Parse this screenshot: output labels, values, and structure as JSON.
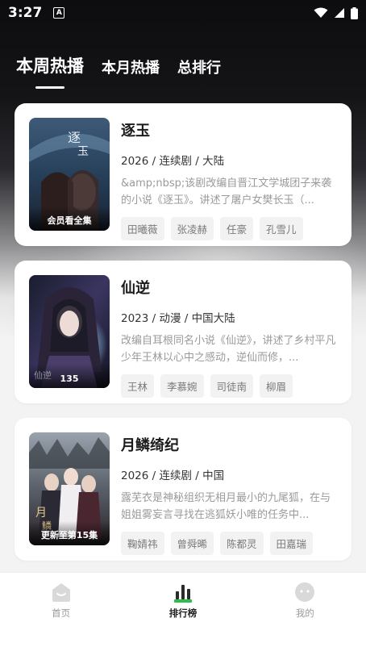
{
  "status": {
    "time": "3:27",
    "app_icon_letter": "A"
  },
  "tabs": [
    {
      "label": "本周热播",
      "active": true
    },
    {
      "label": "本月热播",
      "active": false
    },
    {
      "label": "总排行",
      "active": false
    }
  ],
  "items": [
    {
      "title": "逐玉",
      "meta": "2026 / 连续剧 / 大陆",
      "desc": "&amp;nbsp;该剧改编自晋江文学城团子来袭的小说《逐玉》。讲述了屠户女樊长玉（...",
      "badge": "会员看全集",
      "tags": [
        "田曦薇",
        "张凌赫",
        "任豪",
        "孔雪儿"
      ]
    },
    {
      "title": "仙逆",
      "meta": "2023 / 动漫 / 中国大陆",
      "desc": "改编自耳根同名小说《仙逆》，讲述了乡村平凡少年王林以心中之感动，逆仙而修，...",
      "badge": "135",
      "tags": [
        "王林",
        "李慕婉",
        "司徒南",
        "柳眉"
      ]
    },
    {
      "title": "月鳞绮纪",
      "meta": "2026 / 连续剧 / 中国",
      "desc": "露芜衣是神秘组织无相月最小的九尾狐，在与姐姐雾妄言寻找在逃狐妖小唯的任务中...",
      "badge": "更新至第15集",
      "tags": [
        "鞠婧祎",
        "曾舜晞",
        "陈都灵",
        "田嘉瑞"
      ]
    }
  ],
  "nav": [
    {
      "label": "首页",
      "icon": "home-icon",
      "active": false
    },
    {
      "label": "排行榜",
      "icon": "ranking-icon",
      "active": true
    },
    {
      "label": "我的",
      "icon": "profile-icon",
      "active": false
    }
  ],
  "colors": {
    "accent": "#2dbe4a",
    "nav_icon": "#d9d9d9"
  }
}
